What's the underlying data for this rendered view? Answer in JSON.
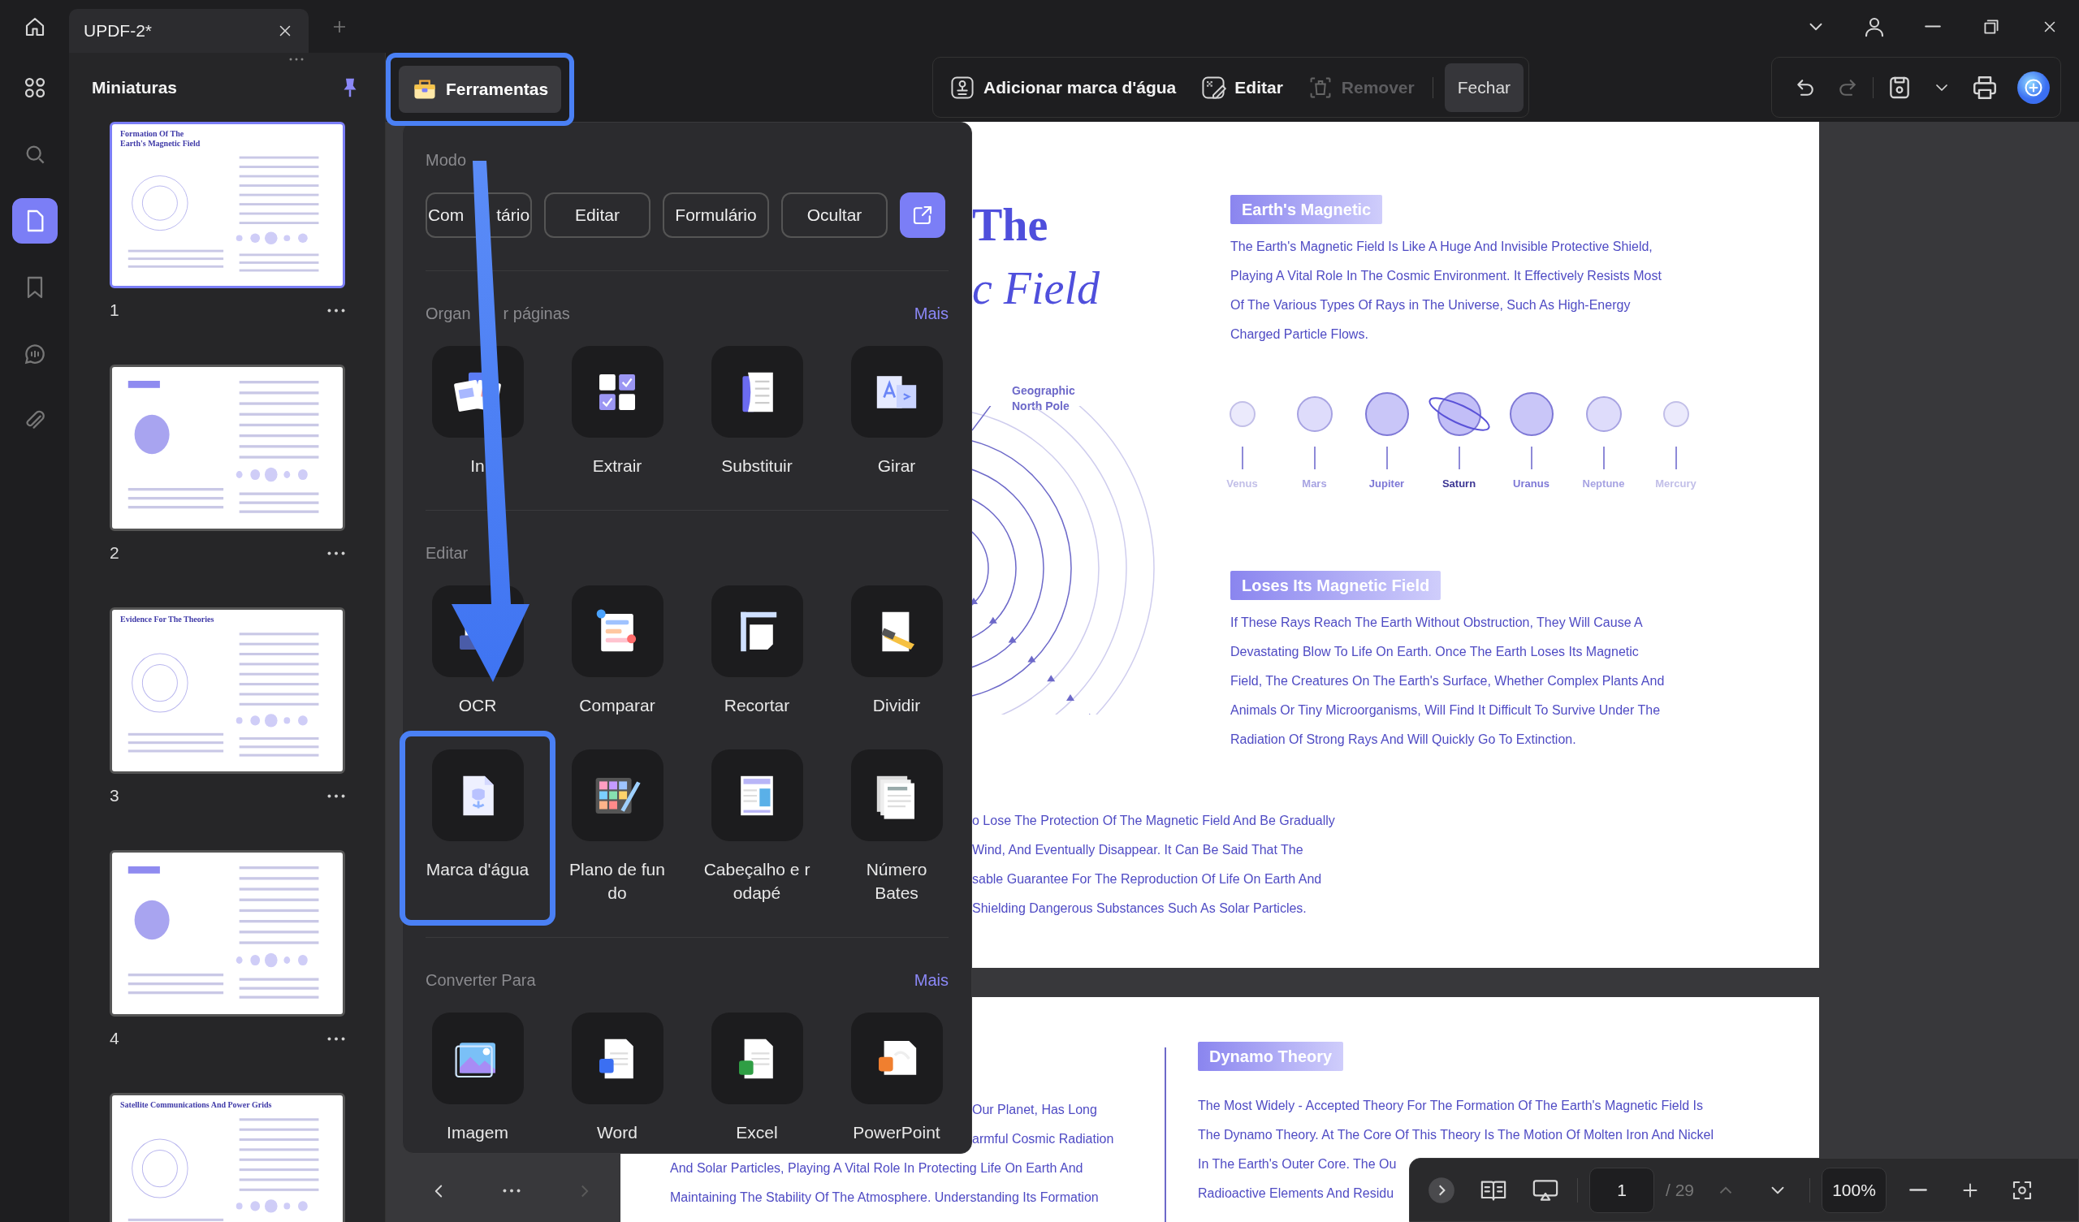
{
  "window": {
    "tab": {
      "title": "UPDF-2*"
    }
  },
  "rail": {
    "items": [
      {
        "selected": false
      },
      {
        "selected": false
      },
      {
        "selected": true
      },
      {
        "selected": false
      },
      {
        "selected": false
      },
      {
        "selected": false
      }
    ]
  },
  "thumbnails": {
    "title": "Miniaturas",
    "pages": [
      {
        "label": "1",
        "heading": "Formation Of The\nEarth's Magnetic Field",
        "selected": true
      },
      {
        "label": "2",
        "selected": false
      },
      {
        "label": "3",
        "heading": "Evidence For The Theories",
        "selected": false
      },
      {
        "label": "4",
        "selected": false
      },
      {
        "heading": "Satellite Communications And Power Grids",
        "selected": false
      }
    ]
  },
  "toolbar": {
    "tools_button": {
      "label": "Ferramentas",
      "highlighted": true
    },
    "actions": [
      {
        "label": "Adicionar marca d'água",
        "disabled": false
      },
      {
        "label": "Editar",
        "disabled": false
      },
      {
        "label": "Remover",
        "disabled": true
      }
    ],
    "close_button": "Fechar",
    "history": [
      {
        "disabled": false
      },
      {
        "disabled": true
      }
    ]
  },
  "tool_panel": {
    "mode_title": "Modo",
    "modes": [
      {
        "label": "Com tário",
        "covered": true
      },
      {
        "label": "Editar",
        "covered": false
      },
      {
        "label": "Formulário",
        "covered": false
      },
      {
        "label": "Ocultar",
        "covered": false
      }
    ],
    "sections": [
      {
        "title": "Organ r páginas",
        "covered": true,
        "more": "Mais",
        "tools": [
          {
            "label": "In",
            "highlighted": false
          },
          {
            "label": "Extrair",
            "highlighted": false
          },
          {
            "label": "Substituir",
            "highlighted": false
          },
          {
            "label": "Girar",
            "highlighted": false
          }
        ]
      },
      {
        "title": "Editar",
        "covered": false,
        "tools": [
          {
            "label": "OCR",
            "highlighted": false
          },
          {
            "label": "Comparar",
            "highlighted": false
          },
          {
            "label": "Recortar",
            "highlighted": false
          },
          {
            "label": "Dividir",
            "highlighted": false
          },
          {
            "label": "Marca d'água",
            "highlighted": true
          },
          {
            "label": "Plano de fun\ndo",
            "highlighted": false
          },
          {
            "label": "Cabeçalho e r\nodapé",
            "highlighted": false
          },
          {
            "label": "Número\nBates",
            "highlighted": false
          }
        ]
      },
      {
        "title": "Converter Para",
        "covered": false,
        "more": "Mais",
        "tools": [
          {
            "label": "Imagem",
            "highlighted": false
          },
          {
            "label": "Word",
            "highlighted": false
          },
          {
            "label": "Excel",
            "highlighted": false
          },
          {
            "label": "PowerPoint",
            "highlighted": false
          }
        ]
      }
    ]
  },
  "panel_nav": {
    "next_disabled": true
  },
  "document": {
    "pages": [
      {
        "kind": "intro",
        "title": [
          {
            "text": "The",
            "italic": false
          },
          {
            "text": "c Field",
            "italic": true
          }
        ],
        "diagram_label": "Geographic\nNorth Pole",
        "sections": [
          {
            "heading": "Earth's Magnetic",
            "lines": [
              "The Earth's Magnetic Field Is Like A Huge And Invisible Protective Shield,",
              "Playing A Vital Role In The Cosmic Environment. It Effectively Resists Most",
              "Of The Various Types Of Rays in The Universe, Such As High-Energy",
              "Charged Particle Flows."
            ]
          },
          {
            "heading": "Loses Its Magnetic Field",
            "lines": [
              "If These Rays Reach The Earth Without Obstruction, They Will Cause A",
              "Devastating Blow To Life On Earth. Once The Earth Loses Its Magnetic",
              "Field, The Creatures On The Earth's Surface, Whether Complex Plants And",
              "Animals Or Tiny Microorganisms, Will Find It Difficult To Survive Under The",
              "Radiation Of Strong Rays And Will Quickly Go To Extinction."
            ]
          }
        ],
        "planets": [
          {
            "name": "Venus",
            "kind": "small",
            "selected": false
          },
          {
            "name": "Mars",
            "kind": "medium",
            "selected": false
          },
          {
            "name": "Jupiter",
            "kind": "large",
            "selected": false
          },
          {
            "name": "Saturn",
            "kind": "ringed",
            "selected": true
          },
          {
            "name": "Uranus",
            "kind": "large",
            "selected": false
          },
          {
            "name": "Neptune",
            "kind": "medium",
            "selected": false
          },
          {
            "name": "Mercury",
            "kind": "small",
            "selected": false
          }
        ],
        "bottom_lines": [
          "o Lose The Protection Of The Magnetic Field And Be Gradually",
          "Wind, And Eventually Disappear. It Can Be Said That The",
          "sable Guarantee For The Reproduction Of Life On Earth And",
          "Shielding Dangerous Substances Such As Solar Particles."
        ]
      },
      {
        "kind": "theory",
        "left": [
          {
            "kind": "cut",
            "lines": [
              "Our Planet, Has Long",
              "armful Cosmic Radiation"
            ]
          },
          {
            "kind": "full",
            "lines": [
              "And Solar Particles, Playing A Vital Role In Protecting Life On Earth And",
              "Maintaining The Stability Of The Atmosphere. Understanding Its Formation"
            ]
          }
        ],
        "heading": "Dynamo Theory",
        "right": [
          {
            "lines": [
              "The Most Widely - Accepted Theory For The Formation Of The Earth's Magnetic Field Is",
              "The Dynamo Theory. At The Core Of This Theory Is The Motion Of Molten Iron And Nickel"
            ]
          },
          {
            "lines": [
              "In The Earth's Outer Core. The Ou",
              "Radioactive Elements And Residu"
            ]
          }
        ]
      }
    ]
  },
  "page_nav": {
    "page": "1",
    "total": "/ 29",
    "zoom": "100%",
    "prev_disabled": true
  }
}
